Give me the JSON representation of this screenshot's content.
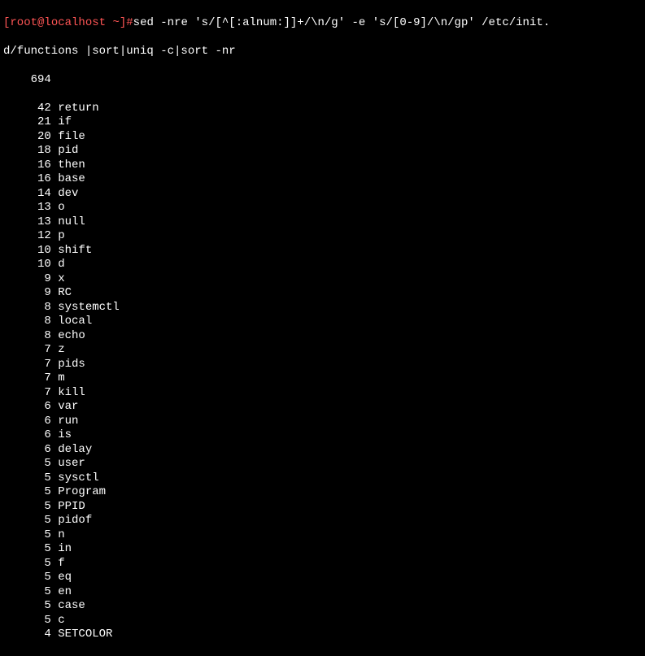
{
  "prompt": {
    "open_bracket": "[",
    "user": "root",
    "at": "@",
    "host": "localhost",
    "space": " ",
    "path": "~",
    "close_bracket": "]",
    "hash": "#"
  },
  "command_line1": "sed -nre 's/[^[:alnum:]]+/\\n/g' -e 's/[0-9]/\\n/gp' /etc/init.",
  "command_line2": "d/functions |sort|uniq -c|sort -nr",
  "output": {
    "first_line": "    694",
    "rows": [
      {
        "count": "     42",
        "word": " return"
      },
      {
        "count": "     21",
        "word": " if"
      },
      {
        "count": "     20",
        "word": " file"
      },
      {
        "count": "     18",
        "word": " pid"
      },
      {
        "count": "     16",
        "word": " then"
      },
      {
        "count": "     16",
        "word": " base"
      },
      {
        "count": "     14",
        "word": " dev"
      },
      {
        "count": "     13",
        "word": " o"
      },
      {
        "count": "     13",
        "word": " null"
      },
      {
        "count": "     12",
        "word": " p"
      },
      {
        "count": "     10",
        "word": " shift"
      },
      {
        "count": "     10",
        "word": " d"
      },
      {
        "count": "      9",
        "word": " x"
      },
      {
        "count": "      9",
        "word": " RC"
      },
      {
        "count": "      8",
        "word": " systemctl"
      },
      {
        "count": "      8",
        "word": " local"
      },
      {
        "count": "      8",
        "word": " echo"
      },
      {
        "count": "      7",
        "word": " z"
      },
      {
        "count": "      7",
        "word": " pids"
      },
      {
        "count": "      7",
        "word": " m"
      },
      {
        "count": "      7",
        "word": " kill"
      },
      {
        "count": "      6",
        "word": " var"
      },
      {
        "count": "      6",
        "word": " run"
      },
      {
        "count": "      6",
        "word": " is"
      },
      {
        "count": "      6",
        "word": " delay"
      },
      {
        "count": "      5",
        "word": " user"
      },
      {
        "count": "      5",
        "word": " sysctl"
      },
      {
        "count": "      5",
        "word": " Program"
      },
      {
        "count": "      5",
        "word": " PPID"
      },
      {
        "count": "      5",
        "word": " pidof"
      },
      {
        "count": "      5",
        "word": " n"
      },
      {
        "count": "      5",
        "word": " in"
      },
      {
        "count": "      5",
        "word": " f"
      },
      {
        "count": "      5",
        "word": " eq"
      },
      {
        "count": "      5",
        "word": " en"
      },
      {
        "count": "      5",
        "word": " case"
      },
      {
        "count": "      5",
        "word": " c"
      },
      {
        "count": "      4",
        "word": " SETCOLOR"
      }
    ]
  }
}
